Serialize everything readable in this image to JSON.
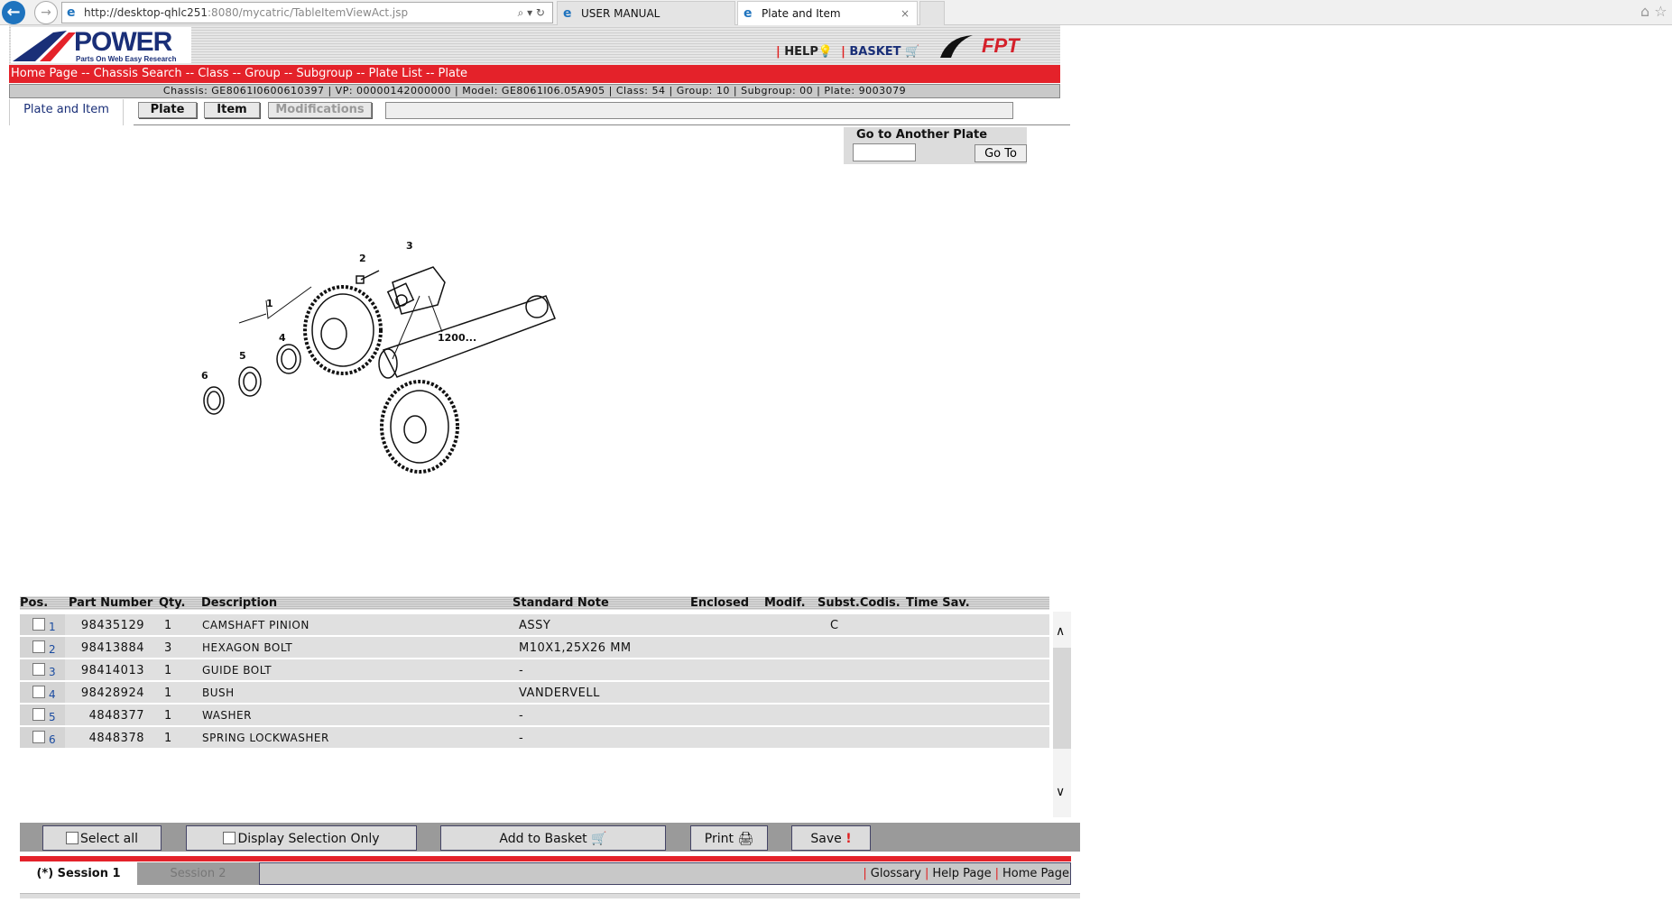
{
  "browser": {
    "url_host": "http://desktop-qhlc251",
    "url_rest": ":8080/mycatric/TableItemViewAct.jsp",
    "tabs": [
      "USER MANUAL",
      "Plate and Item"
    ]
  },
  "header": {
    "logo_title": "POWER",
    "logo_subtitle": "Parts On Web Easy Research",
    "help": "HELP",
    "basket": "BASKET",
    "brand": "FPT"
  },
  "breadcrumb": "Home Page -- Chassis Search -- Class -- Group -- Subgroup -- Plate List -- Plate",
  "info": "Chassis: GE8061I0600610397 | VP: 00000142000000 | Model: GE8061I06.05A905 | Class: 54 | Group: 10 | Subgroup: 00 | Plate: 9003079",
  "tabs": {
    "active": "Plate and Item",
    "plate": "Plate",
    "item": "Item",
    "modifications": "Modifications"
  },
  "goto": {
    "title": "Go to Another Plate",
    "value": "",
    "button": "Go To"
  },
  "diagram": {
    "labels": [
      "1",
      "2",
      "3",
      "4",
      "5",
      "6",
      "1200..."
    ]
  },
  "table": {
    "headers": [
      "Pos.",
      "Part Number",
      "Qty.",
      "Description",
      "Standard Note",
      "Enclosed",
      "Modif.",
      "Subst.Codis.",
      "Time Sav."
    ],
    "rows": [
      {
        "pos": "1",
        "part": "98435129",
        "qty": "1",
        "desc": "CAMSHAFT PINION",
        "note": "ASSY",
        "subst": "C"
      },
      {
        "pos": "2",
        "part": "98413884",
        "qty": "3",
        "desc": "HEXAGON BOLT",
        "note": "M10X1,25X26 MM",
        "subst": ""
      },
      {
        "pos": "3",
        "part": "98414013",
        "qty": "1",
        "desc": "GUIDE BOLT",
        "note": "-",
        "subst": ""
      },
      {
        "pos": "4",
        "part": "98428924",
        "qty": "1",
        "desc": "BUSH",
        "note": "VANDERVELL",
        "subst": ""
      },
      {
        "pos": "5",
        "part": "4848377",
        "qty": "1",
        "desc": "WASHER",
        "note": "-",
        "subst": ""
      },
      {
        "pos": "6",
        "part": "4848378",
        "qty": "1",
        "desc": "SPRING LOCKWASHER",
        "note": "-",
        "subst": ""
      }
    ]
  },
  "toolbar": {
    "select_all": "Select all",
    "display_selection": "Display Selection Only",
    "add_basket": "Add to Basket",
    "print": "Print",
    "save": "Save"
  },
  "footer": {
    "session1": "(*) Session 1",
    "session2": "Session 2",
    "glossary": "Glossary",
    "help_page": "Help Page",
    "home_page": "Home Page"
  }
}
